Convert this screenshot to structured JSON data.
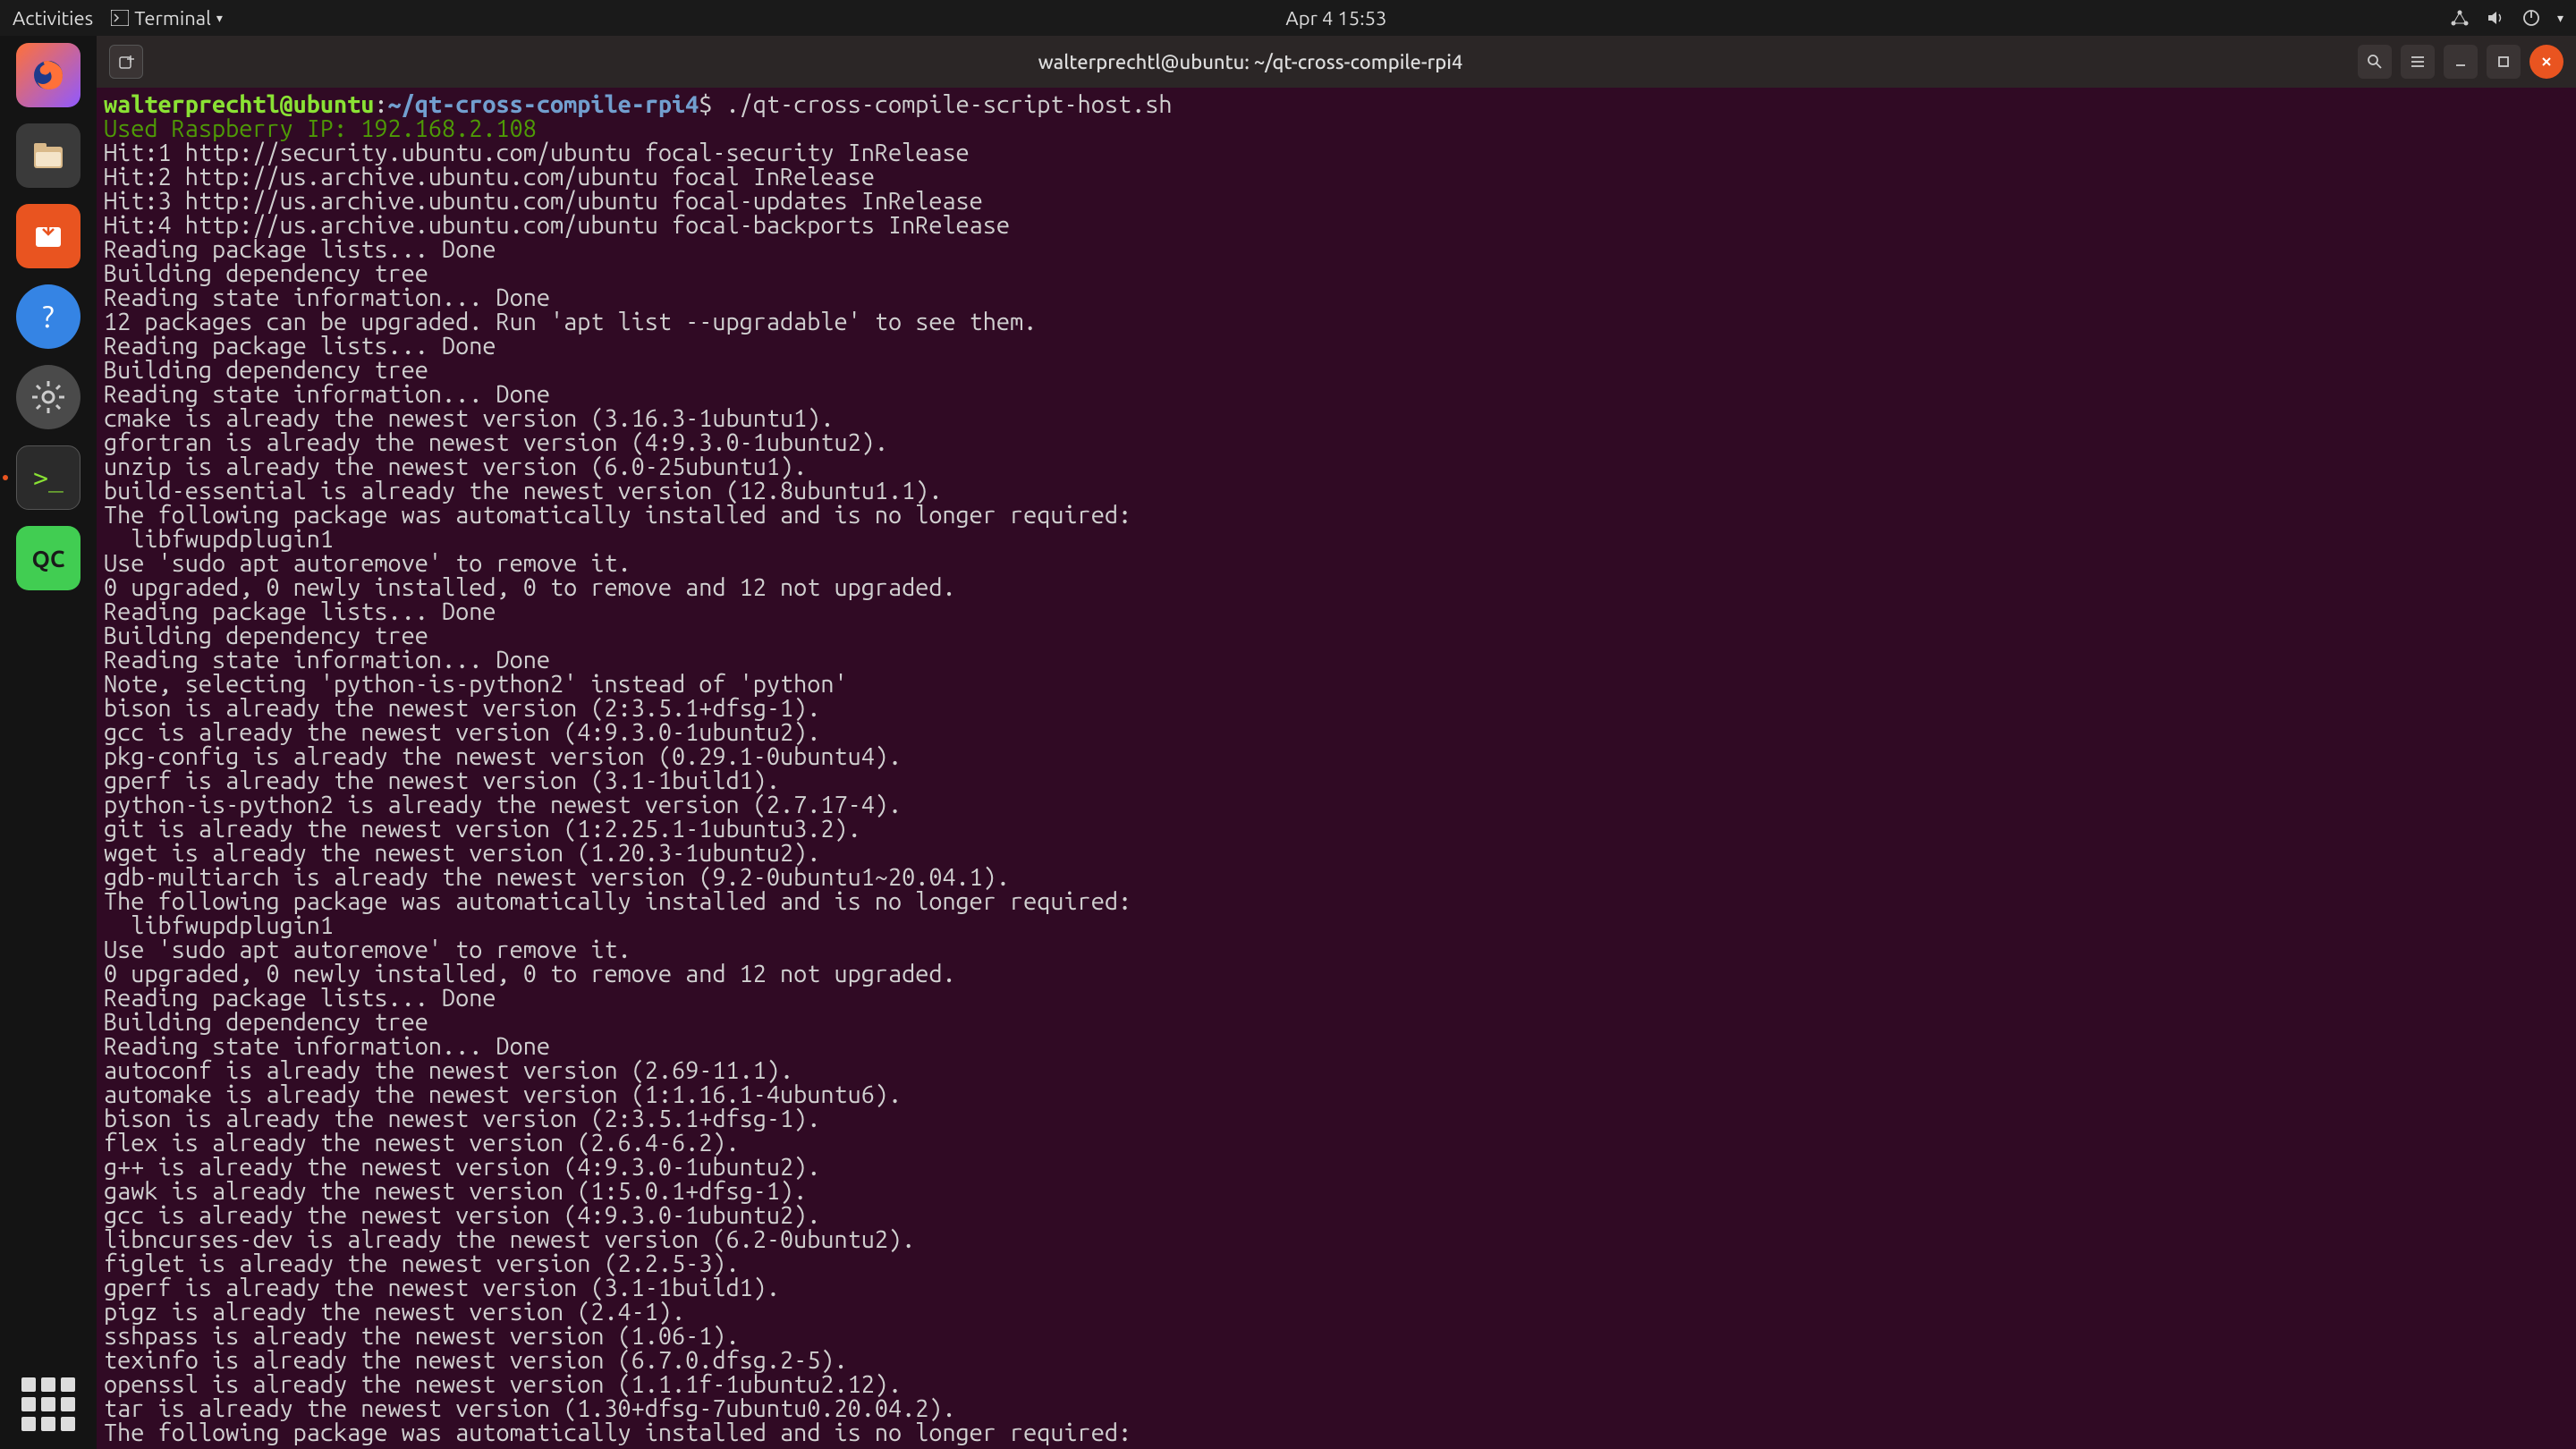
{
  "topbar": {
    "activities": "Activities",
    "app_menu": "Terminal",
    "clock": "Apr 4  15:53"
  },
  "dock": {
    "firefox": "firefox",
    "files": "files",
    "software": "software-center",
    "help": "help",
    "settings": "settings",
    "terminal": "terminal",
    "qtcreator": "QC"
  },
  "window": {
    "title": "walterprechtl@ubuntu: ~/qt-cross-compile-rpi4"
  },
  "prompt": {
    "user_host": "walterprechtl@ubuntu",
    "colon": ":",
    "path": "~/qt-cross-compile-rpi4",
    "dollar": "$",
    "command": " ./qt-cross-compile-script-host.sh"
  },
  "raspberry_line": "Used Raspberry IP: 192.168.2.108",
  "output": [
    "Hit:1 http://security.ubuntu.com/ubuntu focal-security InRelease",
    "Hit:2 http://us.archive.ubuntu.com/ubuntu focal InRelease",
    "Hit:3 http://us.archive.ubuntu.com/ubuntu focal-updates InRelease",
    "Hit:4 http://us.archive.ubuntu.com/ubuntu focal-backports InRelease",
    "Reading package lists... Done",
    "Building dependency tree",
    "Reading state information... Done",
    "12 packages can be upgraded. Run 'apt list --upgradable' to see them.",
    "Reading package lists... Done",
    "Building dependency tree",
    "Reading state information... Done",
    "cmake is already the newest version (3.16.3-1ubuntu1).",
    "gfortran is already the newest version (4:9.3.0-1ubuntu2).",
    "unzip is already the newest version (6.0-25ubuntu1).",
    "build-essential is already the newest version (12.8ubuntu1.1).",
    "The following package was automatically installed and is no longer required:",
    "  libfwupdplugin1",
    "Use 'sudo apt autoremove' to remove it.",
    "0 upgraded, 0 newly installed, 0 to remove and 12 not upgraded.",
    "Reading package lists... Done",
    "Building dependency tree",
    "Reading state information... Done",
    "Note, selecting 'python-is-python2' instead of 'python'",
    "bison is already the newest version (2:3.5.1+dfsg-1).",
    "gcc is already the newest version (4:9.3.0-1ubuntu2).",
    "pkg-config is already the newest version (0.29.1-0ubuntu4).",
    "gperf is already the newest version (3.1-1build1).",
    "python-is-python2 is already the newest version (2.7.17-4).",
    "git is already the newest version (1:2.25.1-1ubuntu3.2).",
    "wget is already the newest version (1.20.3-1ubuntu2).",
    "gdb-multiarch is already the newest version (9.2-0ubuntu1~20.04.1).",
    "The following package was automatically installed and is no longer required:",
    "  libfwupdplugin1",
    "Use 'sudo apt autoremove' to remove it.",
    "0 upgraded, 0 newly installed, 0 to remove and 12 not upgraded.",
    "Reading package lists... Done",
    "Building dependency tree",
    "Reading state information... Done",
    "autoconf is already the newest version (2.69-11.1).",
    "automake is already the newest version (1:1.16.1-4ubuntu6).",
    "bison is already the newest version (2:3.5.1+dfsg-1).",
    "flex is already the newest version (2.6.4-6.2).",
    "g++ is already the newest version (4:9.3.0-1ubuntu2).",
    "gawk is already the newest version (1:5.0.1+dfsg-1).",
    "gcc is already the newest version (4:9.3.0-1ubuntu2).",
    "libncurses-dev is already the newest version (6.2-0ubuntu2).",
    "figlet is already the newest version (2.2.5-3).",
    "gperf is already the newest version (3.1-1build1).",
    "pigz is already the newest version (2.4-1).",
    "sshpass is already the newest version (1.06-1).",
    "texinfo is already the newest version (6.7.0.dfsg.2-5).",
    "openssl is already the newest version (1.1.1f-1ubuntu2.12).",
    "tar is already the newest version (1.30+dfsg-7ubuntu0.20.04.2).",
    "The following package was automatically installed and is no longer required:"
  ]
}
